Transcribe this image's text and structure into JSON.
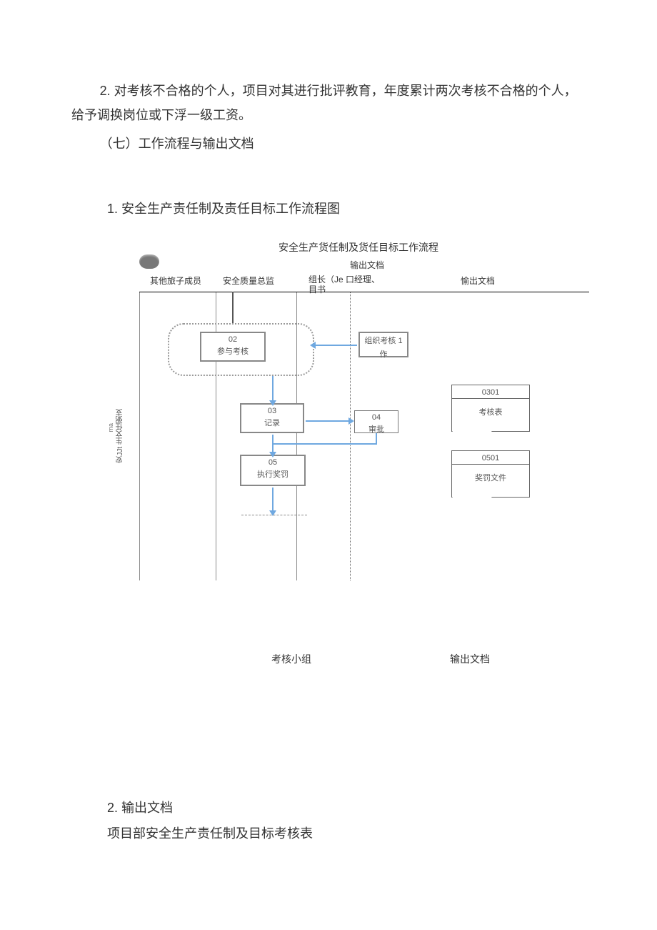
{
  "text": {
    "para2": "2. 对考核不合格的个人，项目对其进行批评教育，年度累计两次考核不合格的个人，给予调换岗位或下浮一级工资。",
    "section7": "（七）工作流程与输出文档",
    "flow_heading": "1. 安全生产责任制及责任目标工作流程图",
    "section2_title": "2. 输出文档",
    "section2_line": "项目部安全生产责任制及目标考核表"
  },
  "diagram": {
    "title": "安全生产货任制及货任目标工作流程",
    "output_label_top": "输出文档",
    "cols": {
      "c1": "其他旅子成员",
      "c2": "安全质量总监",
      "c3a": "组长（Je 口经理、",
      "c3b": "目书",
      "c4": "愉出文档"
    },
    "boxes": {
      "b02_num": "02",
      "b02_lbl": "参与考核",
      "b01_lbla": "组织考核 1",
      "b01_lblb": "作",
      "b03_num": "03",
      "b03_lbl": "记录",
      "b04_num": "04",
      "b04_lbl": "审批",
      "b05_num": "05",
      "b05_lbl": "执行奖罚"
    },
    "docs": {
      "d0301_num": "0301",
      "d0301_lbl": "考核表",
      "d0501_num": "0501",
      "d0501_lbl": "奖罚文件"
    },
    "side_vtext": "安JJt 生文任弼支",
    "side_vtext2": "ma",
    "bottom_left": "考核小组",
    "bottom_right": "输出文档"
  }
}
